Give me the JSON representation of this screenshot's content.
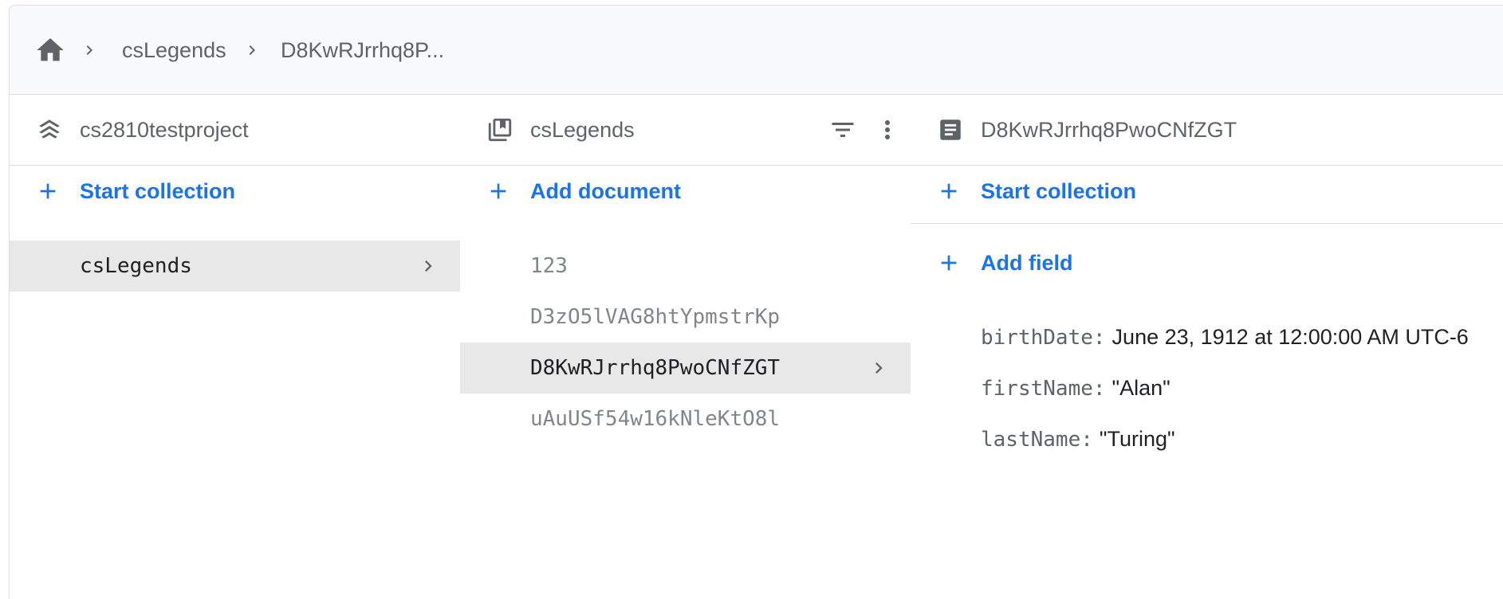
{
  "breadcrumb": {
    "home_icon": "home-icon",
    "items": [
      "csLegends",
      "D8KwRJrrhq8P..."
    ]
  },
  "panels": {
    "project": {
      "icon": "firestore-stack-icon",
      "title": "cs2810testproject",
      "action_label": "Start collection",
      "collections": [
        "csLegends"
      ]
    },
    "collection": {
      "icon": "collection-icon",
      "title": "csLegends",
      "action_label": "Add document",
      "documents": [
        "123",
        "D3zO5lVAG8htYpmstrKp",
        "D8KwRJrrhq8PwoCNfZGT",
        "uAuUSf54w16kNleKtO8l"
      ],
      "selected_index": 2
    },
    "document": {
      "icon": "document-icon",
      "title": "D8KwRJrrhq8PwoCNfZGT",
      "collection_action_label": "Start collection",
      "field_action_label": "Add field",
      "fields": [
        {
          "key": "birthDate:",
          "value": "June 23, 1912 at 12:00:00 AM UTC-6"
        },
        {
          "key": "firstName:",
          "value": "\"Alan\""
        },
        {
          "key": "lastName:",
          "value": "\"Turing\""
        }
      ]
    }
  },
  "colors": {
    "accent": "#1a73e8",
    "selected_row": "#e8e8e8",
    "border": "#dadce0",
    "header_bg": "#f8f9fa"
  }
}
